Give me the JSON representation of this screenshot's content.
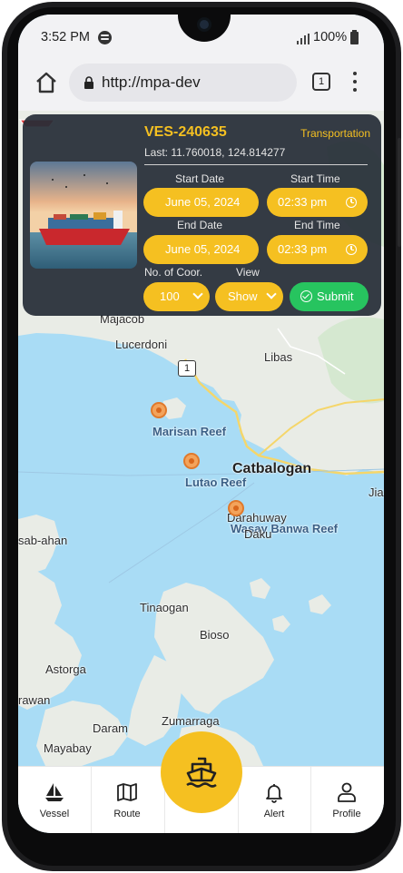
{
  "status_bar": {
    "time": "3:52 PM",
    "battery": "100%",
    "icons": [
      "spotify-icon",
      "signal-icon",
      "battery-icon"
    ]
  },
  "browser": {
    "url": "http://mpa-dev",
    "tab_count": "1"
  },
  "vessel_panel": {
    "vessel_id": "VES-240635",
    "category": "Transportation",
    "last_position": "Last: 11.760018, 124.814277",
    "start_date_label": "Start Date",
    "start_time_label": "Start Time",
    "start_date": "June 05, 2024",
    "start_time": "02:33  pm",
    "end_date_label": "End Date",
    "end_time_label": "End Time",
    "end_date": "June 05, 2024",
    "end_time": "02:33  pm",
    "coords_label": "No. of Coor.",
    "view_label": "View",
    "coords_value": "100",
    "view_value": "Show",
    "submit_label": "Submit"
  },
  "map": {
    "labels": {
      "majacob": "Majacob",
      "lucerdoni": "Lucerdoni",
      "libas": "Libas",
      "road_number": "1",
      "marisan_reef": "Marisan Reef",
      "lutao_reef": "Lutao Reef",
      "catbalogan": "Catbalogan",
      "darahuway": "Darahuway",
      "wasay_banwa_reef": "Wasay Banwa Reef",
      "daku": "Daku",
      "jia": "Jia",
      "sab_ahan": "sab-ahan",
      "tinaogan": "Tinaogan",
      "bioso": "Bioso",
      "astorga": "Astorga",
      "rawan": "rawan",
      "daram": "Daram",
      "zumarraga": "Zumarraga",
      "mayabay": "Mayabay"
    },
    "colors": {
      "water": "#a9dcf5",
      "land": "#e9ece6",
      "marker": "#f3a35b",
      "road": "#f5d66a"
    }
  },
  "bottom_nav": {
    "vessel": "Vessel",
    "route": "Route",
    "alert": "Alert",
    "profile": "Profile",
    "icons": [
      "sailboat-icon",
      "map-icon",
      "ship-icon",
      "bell-icon",
      "user-icon"
    ]
  },
  "theme": {
    "accent": "#f5c021",
    "submit": "#27c45f",
    "panel": "#262d37"
  }
}
